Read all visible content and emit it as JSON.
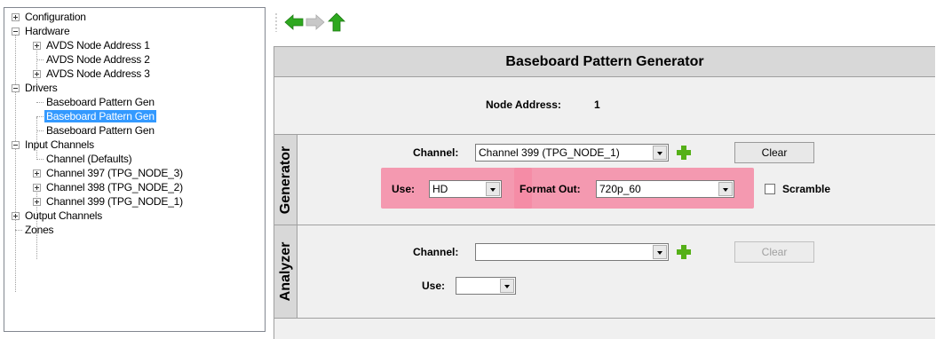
{
  "tree": {
    "nodes": [
      {
        "label": "Configuration",
        "expander": "plus"
      },
      {
        "label": "Hardware",
        "expander": "minus"
      },
      {
        "label": "AVDS Node Address 1",
        "expander": "plus"
      },
      {
        "label": "AVDS Node Address 2",
        "expander": "none"
      },
      {
        "label": "AVDS Node Address 3",
        "expander": "plus"
      },
      {
        "label": "Drivers",
        "expander": "minus"
      },
      {
        "label": "Baseboard Pattern Gen",
        "expander": "none"
      },
      {
        "label": "Baseboard Pattern Gen",
        "expander": "none",
        "selected": true
      },
      {
        "label": "Baseboard Pattern Gen",
        "expander": "none"
      },
      {
        "label": "Input Channels",
        "expander": "minus"
      },
      {
        "label": "Channel  (Defaults)",
        "expander": "none"
      },
      {
        "label": "Channel 397 (TPG_NODE_3)",
        "expander": "plus"
      },
      {
        "label": "Channel 398 (TPG_NODE_2)",
        "expander": "plus"
      },
      {
        "label": "Channel 399 (TPG_NODE_1)",
        "expander": "plus"
      },
      {
        "label": "Output Channels",
        "expander": "plus"
      },
      {
        "label": "Zones",
        "expander": "none"
      }
    ]
  },
  "toolbar": {
    "icons": [
      "back-arrow-icon",
      "forward-arrow-icon",
      "up-arrow-icon"
    ],
    "colors": {
      "active": "#2ea81f",
      "disabled": "#b8b8b8"
    }
  },
  "panel": {
    "title": "Baseboard Pattern Generator",
    "node_address_label": "Node Address:",
    "node_address_value": "1"
  },
  "generator": {
    "tab_label": "Generator",
    "channel_label": "Channel:",
    "channel_value": "Channel 399 (TPG_NODE_1)",
    "clear_label": "Clear",
    "use_label": "Use:",
    "use_value": "HD",
    "format_label": "Format Out:",
    "format_value": "720p_60",
    "scramble_label": "Scramble",
    "scramble_checked": false
  },
  "analyzer": {
    "tab_label": "Analyzer",
    "channel_label": "Channel:",
    "channel_value": "",
    "clear_label": "Clear",
    "use_label": "Use:",
    "use_value": ""
  },
  "colors": {
    "highlight": "#f48aa5",
    "selection": "#3399ff",
    "plus_icon": "#55b018"
  }
}
